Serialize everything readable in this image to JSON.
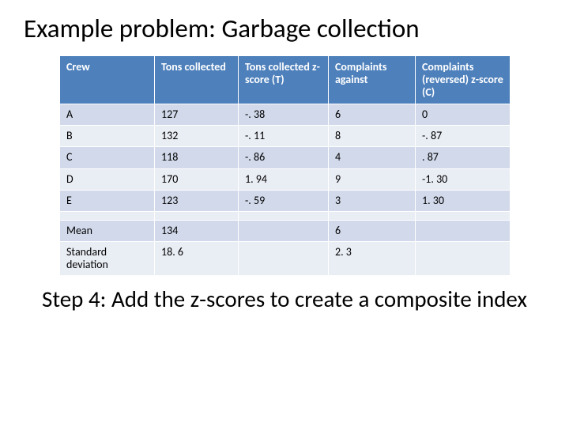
{
  "slide": {
    "title": "Example problem: Garbage collection",
    "step": "Step 4: Add the z-scores to create a composite index"
  },
  "table": {
    "headers": {
      "c1": "Crew",
      "c2": "Tons collected",
      "c3": "Tons collected z-score (T)",
      "c4": "Complaints against",
      "c5": "Complaints (reversed) z-score (C)"
    },
    "rows": [
      {
        "c1": "A",
        "c2": "127",
        "c3": "-. 38",
        "c4": "6",
        "c5": "0"
      },
      {
        "c1": "B",
        "c2": "132",
        "c3": "-. 11",
        "c4": "8",
        "c5": "-. 87"
      },
      {
        "c1": "C",
        "c2": "118",
        "c3": "-. 86",
        "c4": "4",
        "c5": ". 87"
      },
      {
        "c1": "D",
        "c2": "170",
        "c3": "1. 94",
        "c4": "9",
        "c5": "-1. 30"
      },
      {
        "c1": "E",
        "c2": "123",
        "c3": "-. 59",
        "c4": "3",
        "c5": "1. 30"
      },
      {
        "c1": "",
        "c2": "",
        "c3": "",
        "c4": "",
        "c5": ""
      },
      {
        "c1": "Mean",
        "c2": "134",
        "c3": "",
        "c4": "6",
        "c5": ""
      },
      {
        "c1": "Standard deviation",
        "c2": "18. 6",
        "c3": "",
        "c4": "2. 3",
        "c5": ""
      }
    ]
  },
  "chart_data": {
    "type": "table",
    "title": "Example problem: Garbage collection",
    "columns": [
      "Crew",
      "Tons collected",
      "Tons collected z-score (T)",
      "Complaints against",
      "Complaints (reversed) z-score (C)"
    ],
    "rows": [
      [
        "A",
        127,
        -0.38,
        6,
        0
      ],
      [
        "B",
        132,
        -0.11,
        8,
        -0.87
      ],
      [
        "C",
        118,
        -0.86,
        4,
        0.87
      ],
      [
        "D",
        170,
        1.94,
        9,
        -1.3
      ],
      [
        "E",
        123,
        -0.59,
        3,
        1.3
      ]
    ],
    "summary": {
      "Mean": {
        "Tons collected": 134,
        "Complaints against": 6
      },
      "Standard deviation": {
        "Tons collected": 18.6,
        "Complaints against": 2.3
      }
    }
  }
}
